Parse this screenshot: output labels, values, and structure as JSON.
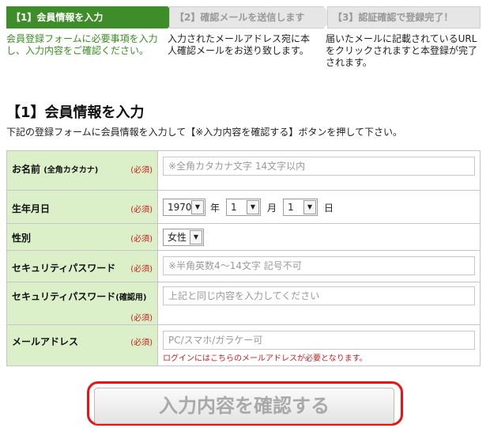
{
  "steps": [
    {
      "label": "【1】会員情報を入力",
      "desc": "会員登録フォームに必要事項を入力し、入力内容をご確認ください。"
    },
    {
      "label": "【2】確認メールを送信します",
      "desc": "入力されたメールアドレス宛に本人確認メールをお送り致します。"
    },
    {
      "label": "【3】認証確認で登録完了！",
      "desc": "届いたメールに記載されているURLをクリックされますと本登録が完了されます。"
    }
  ],
  "section": {
    "heading": "【1】会員情報を入力",
    "lead": "下記の登録フォームに会員情報を入力して【※入力内容を確認する】ボタンを押して下さい。"
  },
  "form": {
    "required": "(必須)",
    "name": {
      "label": "お名前",
      "sub": "(全角カタカナ)",
      "placeholder": "※全角カタカナ文字 14文字以内",
      "value": ""
    },
    "birthday": {
      "label": "生年月日",
      "year": "1970",
      "year_unit": "年",
      "month": "1",
      "month_unit": "月",
      "day": "1",
      "day_unit": "日"
    },
    "gender": {
      "label": "性別",
      "value": "女性"
    },
    "password": {
      "label": "セキュリティパスワード",
      "placeholder": "※半角英数4～14文字 記号不可",
      "value": ""
    },
    "password_confirm": {
      "label": "セキュリティパスワード",
      "sub": "(確認用)",
      "placeholder": "上記と同じ内容を入力してください",
      "value": ""
    },
    "email": {
      "label": "メールアドレス",
      "placeholder": "PC/スマホ/ガラケー可",
      "value": "",
      "note": "ログインにはこちらのメールアドレスが必要となります。"
    }
  },
  "submit": {
    "label": "入力内容を確認する"
  },
  "colors": {
    "step_active": "#3f8d2a",
    "label_bg": "#dbefc9",
    "required": "#c81e1e",
    "highlight": "#e81414"
  }
}
